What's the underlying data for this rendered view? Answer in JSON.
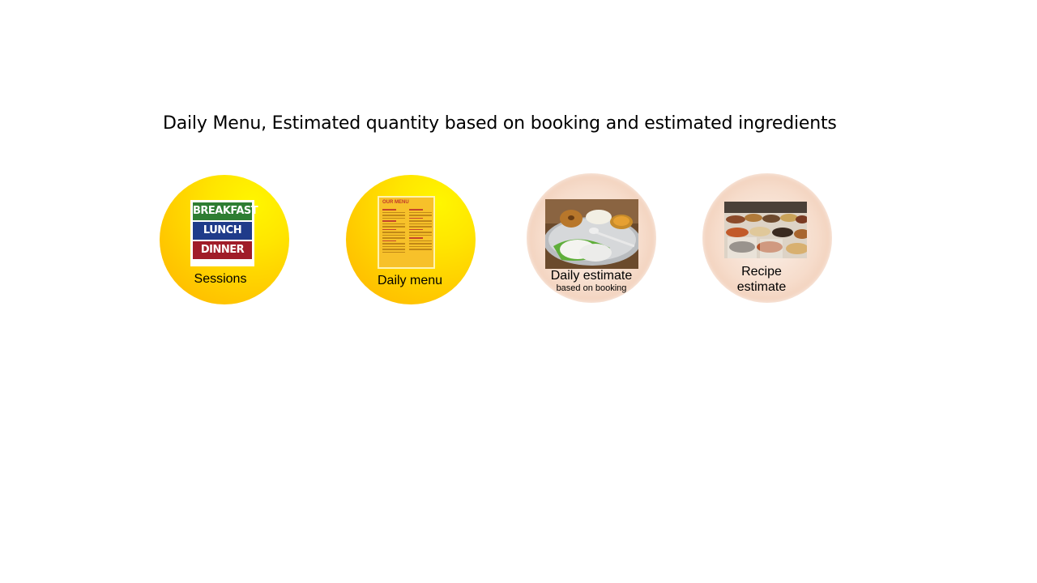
{
  "slide": {
    "title": "Daily Menu, Estimated quantity based on booking and estimated ingredients"
  },
  "items": [
    {
      "label": "Sessions",
      "logo_words": [
        "BREAKFAST",
        "LUNCH",
        "DINNER"
      ]
    },
    {
      "label": "Daily menu",
      "card_title": "OUR MENU"
    },
    {
      "label": "Daily estimate",
      "sublabel": "based on booking"
    },
    {
      "label_line1": "Recipe",
      "label_line2": "estimate"
    }
  ],
  "colors": {
    "circle_yellow": "#ffd200",
    "circle_peach": "#f4dccc"
  }
}
